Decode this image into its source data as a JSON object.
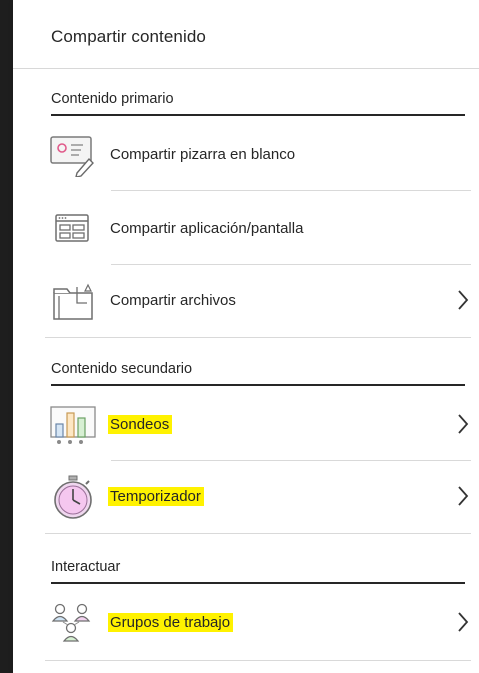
{
  "panel": {
    "title": "Compartir contenido"
  },
  "sections": [
    {
      "heading": "Contenido primario",
      "items": [
        {
          "label": "Compartir pizarra en blanco",
          "icon": "whiteboard-icon",
          "has_chevron": false,
          "highlighted": false
        },
        {
          "label": "Compartir aplicación/pantalla",
          "icon": "application-window-icon",
          "has_chevron": false,
          "highlighted": false
        },
        {
          "label": "Compartir archivos",
          "icon": "folder-icon",
          "has_chevron": true,
          "highlighted": false
        }
      ]
    },
    {
      "heading": "Contenido secundario",
      "items": [
        {
          "label": "Sondeos",
          "icon": "poll-chart-icon",
          "has_chevron": true,
          "highlighted": true
        },
        {
          "label": "Temporizador",
          "icon": "stopwatch-icon",
          "has_chevron": true,
          "highlighted": true
        }
      ]
    },
    {
      "heading": "Interactuar",
      "items": [
        {
          "label": "Grupos de trabajo",
          "icon": "breakout-groups-icon",
          "has_chevron": true,
          "highlighted": true
        }
      ]
    }
  ],
  "colors": {
    "highlight": "#fff200",
    "text": "#262626",
    "left_bar": "#1e1e1e",
    "divider": "#d9d9d9"
  }
}
